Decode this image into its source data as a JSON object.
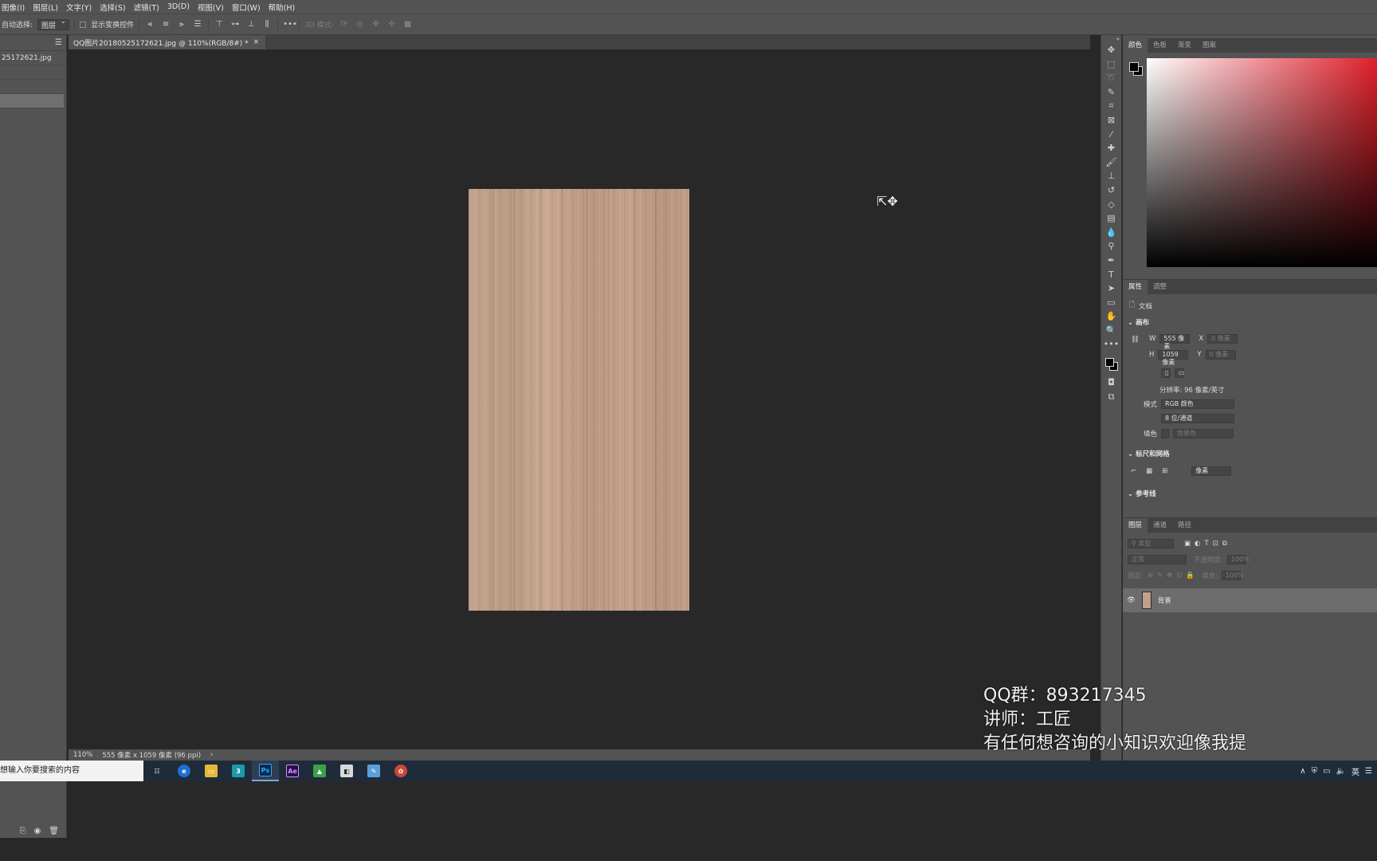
{
  "menu": [
    "图像(I)",
    "图层(L)",
    "文字(Y)",
    "选择(S)",
    "滤镜(T)",
    "3D(D)",
    "视图(V)",
    "窗口(W)",
    "帮助(H)"
  ],
  "options": {
    "auto_select_label": "自动选择:",
    "auto_select_value": "图层",
    "show_transform_label": "显示变换控件",
    "mode_3d_label": "3D 模式:"
  },
  "left_panel": {
    "file_name": "25172621.jpg"
  },
  "document": {
    "tab_title": "QQ图片20180525172621.jpg @ 110%(RGB/8#) *",
    "close_glyph": "×"
  },
  "status": {
    "zoom": "110%",
    "info": "555 像素 x 1059 像素 (96 ppi)",
    "arrow": "›"
  },
  "color_panel": {
    "tabs": [
      "颜色",
      "色板",
      "渐变",
      "图案"
    ]
  },
  "properties": {
    "tabs": [
      "属性",
      "调整"
    ],
    "doc_label": "文档",
    "canvas_section": "画布",
    "w_label": "W",
    "w_value": "555 像素",
    "h_label": "H",
    "h_value": "1059 像素",
    "x_label": "X",
    "x_value": "0 像素",
    "y_label": "Y",
    "y_value": "0 像素",
    "resolution": "分辨率: 96 像素/英寸",
    "mode_label": "模式",
    "mode_value": "RGB 颜色",
    "depth_value": "8 位/通道",
    "fill_label": "填色",
    "fill_value": "背景色",
    "rulers_section": "标尺和网格",
    "units_value": "像素",
    "guides_section": "参考线"
  },
  "layers": {
    "tabs": [
      "图层",
      "通道",
      "路径"
    ],
    "filter_placeholder": "类型",
    "blend_mode": "正常",
    "opacity_label": "不透明度:",
    "opacity_value": "100%",
    "lock_label": "锁定:",
    "fill_label": "填充:",
    "fill_value": "100%",
    "layer_name": "背景"
  },
  "watermark": {
    "line1": "QQ群：893217345",
    "line2": "讲师：工匠",
    "line3": "有任何想咨询的小知识欢迎像我提"
  },
  "taskbar": {
    "search_placeholder": "想输入你要搜索的内容",
    "apps": [
      {
        "icon": "task-view-icon",
        "label": "☷",
        "bg": "transparent"
      },
      {
        "icon": "browser-icon",
        "label": "e",
        "bg": "#1e6fd0"
      },
      {
        "icon": "folder-icon",
        "label": "▭",
        "bg": "#e8b73a"
      },
      {
        "icon": "3dsmax-icon",
        "label": "3",
        "bg": "#1b9aa8"
      },
      {
        "icon": "photoshop-icon",
        "label": "Ps",
        "bg": "#0b2a4a"
      },
      {
        "icon": "aftereffects-icon",
        "label": "Ae",
        "bg": "#2a0f48"
      },
      {
        "icon": "image-viewer-icon",
        "label": "▲",
        "bg": "#3aa14a"
      },
      {
        "icon": "screen-capture-icon",
        "label": "◧",
        "bg": "#d9d9d9"
      },
      {
        "icon": "image-editor-icon",
        "label": "✎",
        "bg": "#5aa0d8"
      },
      {
        "icon": "bird-app-icon",
        "label": "✿",
        "bg": "#c8483a"
      }
    ],
    "ime_label": "英"
  },
  "colors": {
    "wood_base": "#c1a08a",
    "picker_hue": "#e0202b"
  }
}
